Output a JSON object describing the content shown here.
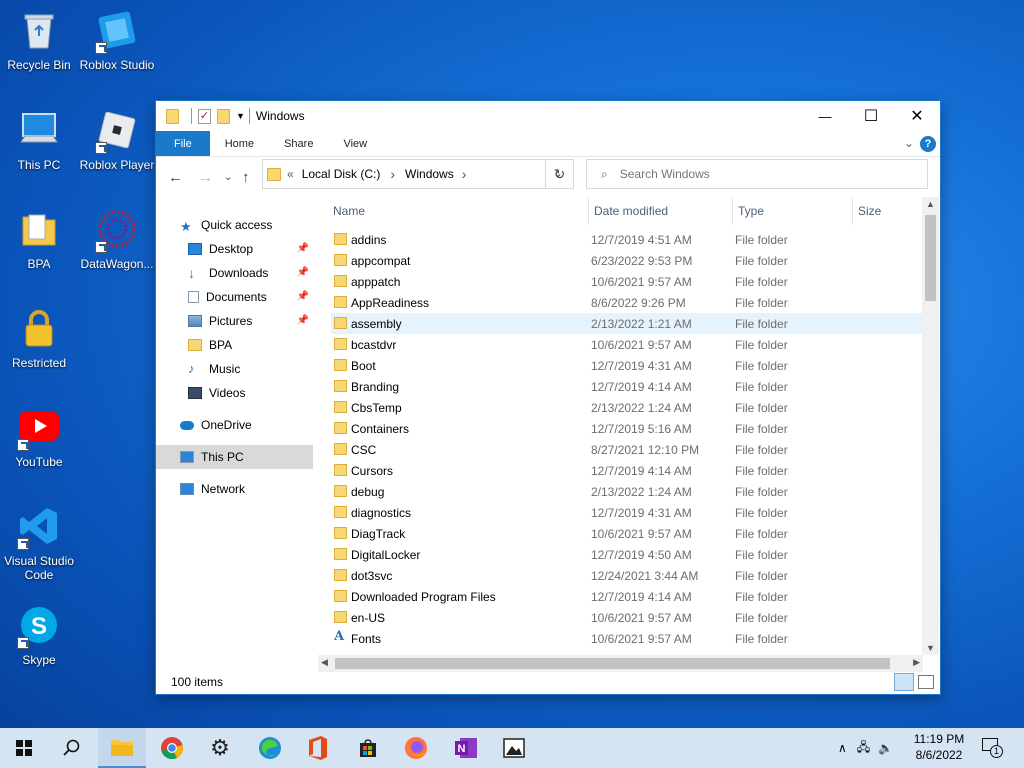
{
  "desktop": {
    "icons": [
      {
        "label": "Recycle Bin"
      },
      {
        "label": "Roblox Studio"
      },
      {
        "label": "This PC"
      },
      {
        "label": "Roblox Player"
      },
      {
        "label": "BPA"
      },
      {
        "label": "DataWagon..."
      },
      {
        "label": "Restricted"
      },
      {
        "label": "YouTube"
      },
      {
        "label": "Visual Studio Code"
      },
      {
        "label": "Skype"
      }
    ]
  },
  "window": {
    "title": "Windows",
    "controls": {
      "minimize": "—",
      "maximize": "☐",
      "close": "✕"
    },
    "ribbon": {
      "tabs": [
        "File",
        "Home",
        "Share",
        "View"
      ]
    },
    "address": {
      "prefix": "«",
      "crumbs": [
        "Local Disk (C:)",
        "Windows"
      ],
      "separator": "›"
    },
    "search": {
      "placeholder": "Search Windows"
    },
    "nav": {
      "quick_access": "Quick access",
      "items": [
        {
          "label": "Desktop",
          "pinned": true
        },
        {
          "label": "Downloads",
          "pinned": true
        },
        {
          "label": "Documents",
          "pinned": true
        },
        {
          "label": "Pictures",
          "pinned": true
        },
        {
          "label": "BPA",
          "pinned": false
        },
        {
          "label": "Music",
          "pinned": false
        },
        {
          "label": "Videos",
          "pinned": false
        }
      ],
      "onedrive": "OneDrive",
      "this_pc": "This PC",
      "network": "Network"
    },
    "columns": {
      "name": "Name",
      "date": "Date modified",
      "type": "Type",
      "size": "Size"
    },
    "files": [
      {
        "name": "addins",
        "date": "12/7/2019 4:51 AM",
        "type": "File folder"
      },
      {
        "name": "appcompat",
        "date": "6/23/2022 9:53 PM",
        "type": "File folder"
      },
      {
        "name": "apppatch",
        "date": "10/6/2021 9:57 AM",
        "type": "File folder"
      },
      {
        "name": "AppReadiness",
        "date": "8/6/2022 9:26 PM",
        "type": "File folder"
      },
      {
        "name": "assembly",
        "date": "2/13/2022 1:21 AM",
        "type": "File folder"
      },
      {
        "name": "bcastdvr",
        "date": "10/6/2021 9:57 AM",
        "type": "File folder"
      },
      {
        "name": "Boot",
        "date": "12/7/2019 4:31 AM",
        "type": "File folder"
      },
      {
        "name": "Branding",
        "date": "12/7/2019 4:14 AM",
        "type": "File folder"
      },
      {
        "name": "CbsTemp",
        "date": "2/13/2022 1:24 AM",
        "type": "File folder"
      },
      {
        "name": "Containers",
        "date": "12/7/2019 5:16 AM",
        "type": "File folder"
      },
      {
        "name": "CSC",
        "date": "8/27/2021 12:10 PM",
        "type": "File folder"
      },
      {
        "name": "Cursors",
        "date": "12/7/2019 4:14 AM",
        "type": "File folder"
      },
      {
        "name": "debug",
        "date": "2/13/2022 1:24 AM",
        "type": "File folder"
      },
      {
        "name": "diagnostics",
        "date": "12/7/2019 4:31 AM",
        "type": "File folder"
      },
      {
        "name": "DiagTrack",
        "date": "10/6/2021 9:57 AM",
        "type": "File folder"
      },
      {
        "name": "DigitalLocker",
        "date": "12/7/2019 4:50 AM",
        "type": "File folder"
      },
      {
        "name": "dot3svc",
        "date": "12/24/2021 3:44 AM",
        "type": "File folder"
      },
      {
        "name": "Downloaded Program Files",
        "date": "12/7/2019 4:14 AM",
        "type": "File folder"
      },
      {
        "name": "en-US",
        "date": "10/6/2021 9:57 AM",
        "type": "File folder"
      },
      {
        "name": "Fonts",
        "date": "10/6/2021 9:57 AM",
        "type": "File folder"
      }
    ],
    "status": "100 items"
  },
  "taskbar": {
    "apps": [
      "start",
      "search",
      "file-explorer",
      "chrome",
      "settings",
      "edge",
      "office",
      "store",
      "firefox",
      "onenote",
      "photos"
    ],
    "time": "11:19 PM",
    "date": "8/6/2022",
    "notifications": "1"
  },
  "colors": {
    "accent": "#1979ca",
    "selection": "#e5f3ff",
    "taskbar": "#d5e4f3",
    "folder": "#f8d775"
  }
}
